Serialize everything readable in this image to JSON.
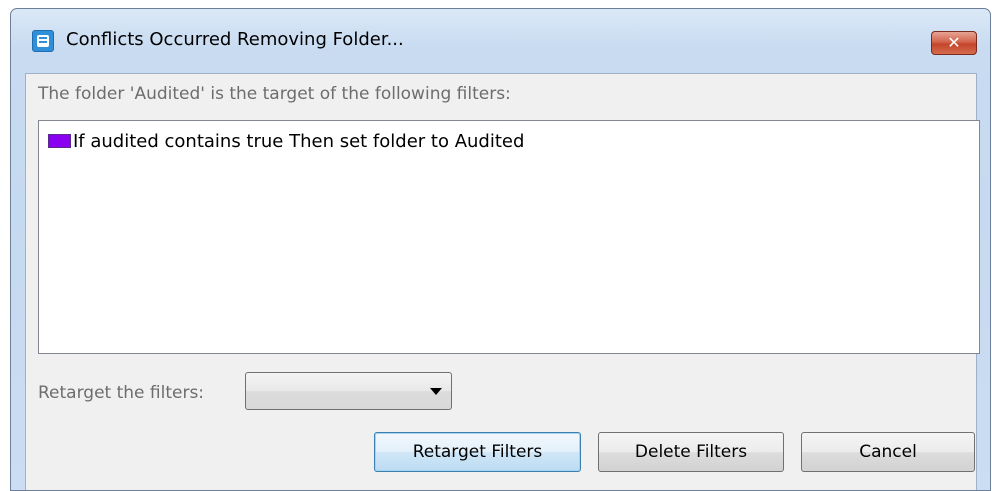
{
  "window": {
    "title": "Conflicts Occurred Removing Folder...",
    "close_label": "✕"
  },
  "dialog": {
    "prompt": "The folder 'Audited' is the target of the following filters:",
    "filters": [
      {
        "text": "If audited contains true Then set folder to Audited",
        "color": "#8a00f0"
      }
    ],
    "retarget_label": "Retarget the filters:",
    "retarget_value": ""
  },
  "buttons": {
    "retarget": "Retarget Filters",
    "delete": "Delete Filters",
    "cancel": "Cancel"
  },
  "colors": {
    "accent": "#3c7fb1",
    "close_button": "#c4452b"
  }
}
